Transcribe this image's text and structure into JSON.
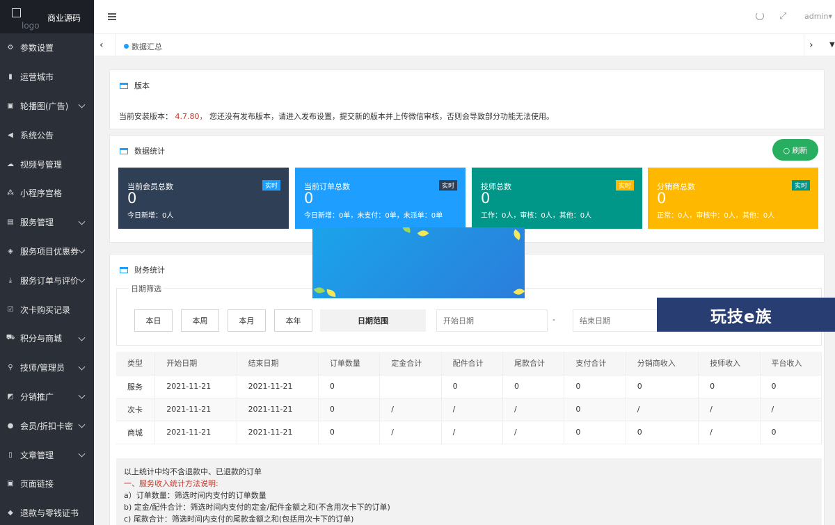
{
  "sidebar": {
    "brand": "商业源码",
    "logo_text": "logo",
    "items": [
      {
        "label": "参数设置",
        "icon": "gear-icon",
        "glyph": "⚙",
        "expand": false
      },
      {
        "label": "运营城市",
        "icon": "building-icon",
        "glyph": "▮",
        "expand": false
      },
      {
        "label": "轮播图(广告)",
        "icon": "image-icon",
        "glyph": "▣",
        "expand": true
      },
      {
        "label": "系统公告",
        "icon": "speaker-icon",
        "glyph": "◀",
        "expand": false
      },
      {
        "label": "视频号管理",
        "icon": "cloud-icon",
        "glyph": "☁",
        "expand": false
      },
      {
        "label": "小程序宫格",
        "icon": "sitemap-icon",
        "glyph": "⁂",
        "expand": false
      },
      {
        "label": "服务管理",
        "icon": "list-icon",
        "glyph": "▤",
        "expand": true
      },
      {
        "label": "服务项目优惠券",
        "icon": "tag-icon",
        "glyph": "◈",
        "expand": true
      },
      {
        "label": "服务订单与评价",
        "icon": "download-icon",
        "glyph": "⤓",
        "expand": true
      },
      {
        "label": "次卡购买记录",
        "icon": "checkbox-icon",
        "glyph": "☑",
        "expand": false
      },
      {
        "label": "积分与商城",
        "icon": "cart-icon",
        "glyph": "⛟",
        "expand": true
      },
      {
        "label": "技师/管理员",
        "icon": "user-icon",
        "glyph": "⚲",
        "expand": true
      },
      {
        "label": "分销推广",
        "icon": "share-icon",
        "glyph": "◩",
        "expand": true
      },
      {
        "label": "会员/折扣卡密",
        "icon": "member-icon",
        "glyph": "●",
        "expand": true
      },
      {
        "label": "文章管理",
        "icon": "document-icon",
        "glyph": "▯",
        "expand": true
      },
      {
        "label": "页面链接",
        "icon": "link-icon",
        "glyph": "▣",
        "expand": false
      },
      {
        "label": "退款与零钱证书",
        "icon": "refund-icon",
        "glyph": "◆",
        "expand": false
      }
    ]
  },
  "header": {
    "user": "admin▾",
    "tab_label": "数据汇总"
  },
  "version_card": {
    "title": "版本",
    "prefix": "当前安装版本：",
    "version": "4.7.80，",
    "message": "您还没有发布版本，请进入发布设置，提交新的版本并上传微信审核，否则会导致部分功能无法使用。"
  },
  "stats_card": {
    "title": "数据统计",
    "refresh_label": "○ 刷新",
    "stats": [
      {
        "title": "当前会员总数",
        "value": "0",
        "sub": "今日新增：0人",
        "badge": "实时",
        "bg": "#2f4056",
        "badge_bg": "#1e9fff"
      },
      {
        "title": "当前订单总数",
        "value": "0",
        "sub": "今日新增：0单，未支付：0单，未派单：0单",
        "badge": "实时",
        "bg": "#1e9fff",
        "badge_bg": "#2f4056"
      },
      {
        "title": "技师总数",
        "value": "0",
        "sub": "工作：0人，审核：0人，其他：0人",
        "badge": "实时",
        "bg": "#009688",
        "badge_bg": "#ffb800"
      },
      {
        "title": "分销商总数",
        "value": "0",
        "sub": "正常：0人，审核中：0人，其他：0人",
        "badge": "实时",
        "bg": "#ffb800",
        "badge_bg": "#009688"
      }
    ]
  },
  "finance_card": {
    "title": "财务统计",
    "filter_legend": "日期筛选",
    "buttons": [
      "本日",
      "本周",
      "本月",
      "本年"
    ],
    "range_label": "日期范围",
    "start_placeholder": "开始日期",
    "end_placeholder": "结束日期",
    "dash": "-",
    "table": {
      "headers": [
        "类型",
        "开始日期",
        "结束日期",
        "订单数量",
        "定金合计",
        "配件合计",
        "尾款合计",
        "支付合计",
        "分销商收入",
        "技师收入",
        "平台收入"
      ],
      "rows": [
        [
          "服务",
          "2021-11-21",
          "2021-11-21",
          "0",
          "",
          "0",
          "0",
          "0",
          "0",
          "0",
          "0"
        ],
        [
          "次卡",
          "2021-11-21",
          "2021-11-21",
          "0",
          "/",
          "/",
          "/",
          "0",
          "/",
          "/",
          "/"
        ],
        [
          "商城",
          "2021-11-21",
          "2021-11-21",
          "0",
          "/",
          "/",
          "/",
          "0",
          "0",
          "/",
          "0"
        ]
      ]
    },
    "notes": {
      "line1": "以上统计中均不含退款中、已退款的订单",
      "line2_prefix": "一、",
      "line2_red": "服务收入统计方法说明:",
      "line3": "a）订单数量：筛选时间内支付的订单数量",
      "line4": "b) 定金/配件合计：筛选时间内支付的定金/配件金额之和(不含用次卡下的订单)",
      "line5": "c) 尾款合计：筛选时间内支付的尾款金额之和(包括用次卡下的订单)"
    }
  },
  "watermark": "玩技e族"
}
